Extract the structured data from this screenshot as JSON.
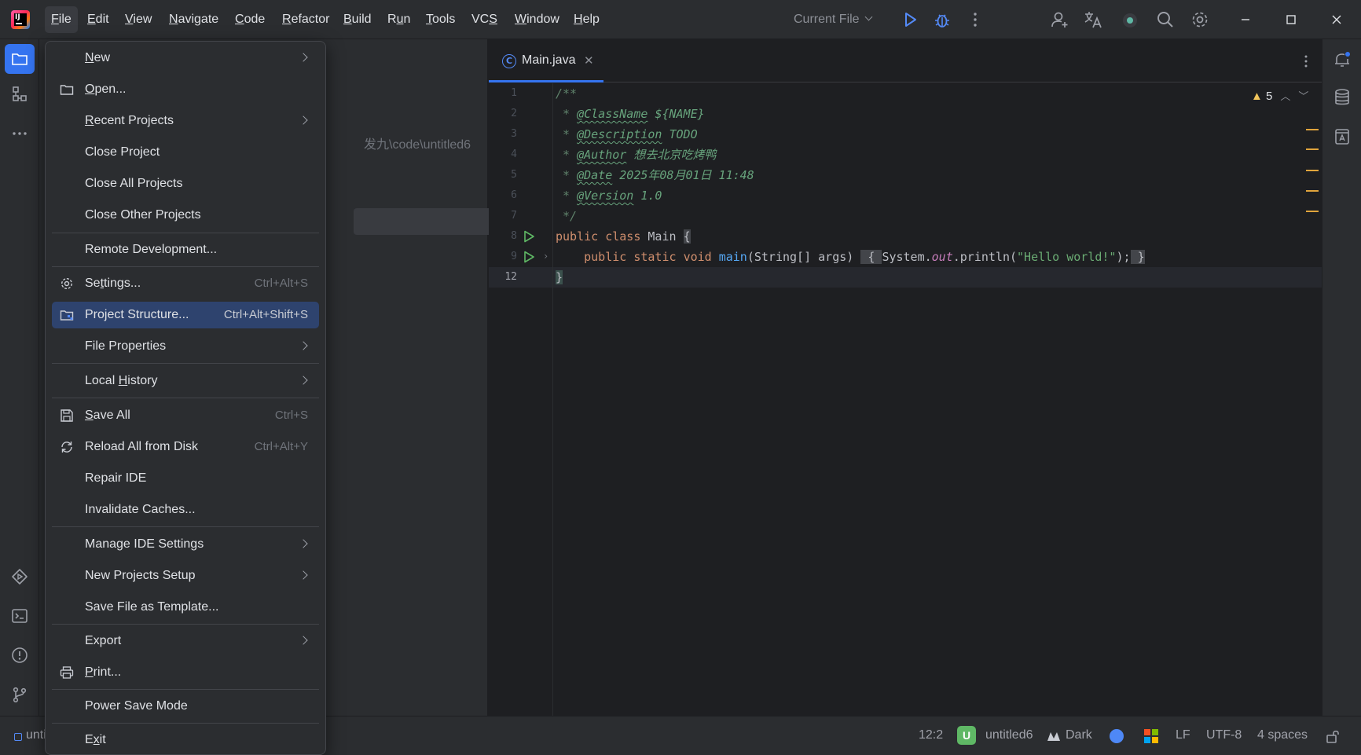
{
  "menubar": {
    "items": [
      {
        "label": "File",
        "mnemonic": "F"
      },
      {
        "label": "Edit",
        "mnemonic": "E"
      },
      {
        "label": "View",
        "mnemonic": "V"
      },
      {
        "label": "Navigate",
        "mnemonic": "N"
      },
      {
        "label": "Code",
        "mnemonic": "C"
      },
      {
        "label": "Refactor",
        "mnemonic": "R"
      },
      {
        "label": "Build",
        "mnemonic": "B"
      },
      {
        "label": "Run",
        "mnemonic": "u"
      },
      {
        "label": "Tools",
        "mnemonic": "T"
      },
      {
        "label": "VCS",
        "mnemonic": "S"
      },
      {
        "label": "Window",
        "mnemonic": "W"
      },
      {
        "label": "Help",
        "mnemonic": "H"
      }
    ],
    "active": "File"
  },
  "toolbar": {
    "run_config": "Current File",
    "icons": [
      "run-icon",
      "debug-icon",
      "more-vertical-icon",
      "add-user-icon",
      "translate-icon",
      "ai-assistant-icon",
      "search-icon",
      "settings-icon"
    ]
  },
  "window_controls": [
    "minimize-icon",
    "maximize-icon",
    "close-icon"
  ],
  "project_panel": {
    "path_fragment": "发九\\code\\untitled6"
  },
  "file_menu": {
    "items": [
      {
        "label": "New",
        "mnemonic": "N",
        "submenu": true
      },
      {
        "label": "Open...",
        "mnemonic": "O",
        "icon": "folder-icon"
      },
      {
        "label": "Recent Projects",
        "mnemonic": "R",
        "submenu": true
      },
      {
        "label": "Close Project"
      },
      {
        "label": "Close All Projects"
      },
      {
        "label": "Close Other Projects"
      },
      {
        "separator": true
      },
      {
        "label": "Remote Development..."
      },
      {
        "separator": true
      },
      {
        "label": "Settings...",
        "mnemonic": "t",
        "shortcut": "Ctrl+Alt+S",
        "icon": "gear-icon"
      },
      {
        "label": "Project Structure...",
        "shortcut": "Ctrl+Alt+Shift+S",
        "icon": "project-structure-icon",
        "selected": true
      },
      {
        "label": "File Properties",
        "submenu": true
      },
      {
        "separator": true
      },
      {
        "label": "Local History",
        "mnemonic": "H",
        "submenu": true
      },
      {
        "separator": true
      },
      {
        "label": "Save All",
        "mnemonic": "S",
        "shortcut": "Ctrl+S",
        "icon": "save-icon"
      },
      {
        "label": "Reload All from Disk",
        "shortcut": "Ctrl+Alt+Y",
        "icon": "reload-icon"
      },
      {
        "label": "Repair IDE"
      },
      {
        "label": "Invalidate Caches..."
      },
      {
        "separator": true
      },
      {
        "label": "Manage IDE Settings",
        "submenu": true
      },
      {
        "label": "New Projects Setup",
        "submenu": true
      },
      {
        "label": "Save File as Template..."
      },
      {
        "separator": true
      },
      {
        "label": "Export",
        "submenu": true
      },
      {
        "label": "Print...",
        "mnemonic": "P",
        "icon": "print-icon"
      },
      {
        "separator": true
      },
      {
        "label": "Power Save Mode"
      },
      {
        "separator": true
      },
      {
        "label": "Exit",
        "mnemonic": "x"
      }
    ]
  },
  "editor": {
    "tab": {
      "label": "Main.java",
      "icon": "java-class-icon"
    },
    "warnings": {
      "count": "5"
    },
    "line_numbers": [
      "1",
      "2",
      "3",
      "4",
      "5",
      "6",
      "7",
      "8",
      "9",
      "12"
    ],
    "current_line": "12",
    "doc": {
      "open": "/**",
      "class_tag": "@ClassName",
      "class_val": "${NAME}",
      "desc_tag": "@Description",
      "desc_val": "TODO",
      "author_tag": "@Author",
      "author_val": "想去北京吃烤鸭",
      "date_tag": "@Date",
      "date_val": "2025年08月01日 11:48",
      "version_tag": "@Version",
      "version_val": "1.0",
      "close": "*/"
    },
    "code": {
      "kw_public": "public",
      "kw_class": "class",
      "class_name": "Main",
      "kw_static": "static",
      "kw_void": "void",
      "method_name": "main",
      "params": "(String[] args)",
      "system": "System.",
      "out": "out",
      "println": ".println(",
      "string": "\"Hello world!\"",
      "stmt_end": ");",
      "open_brace": "{",
      "close_brace": "}"
    }
  },
  "statusbar": {
    "crumb": "unti",
    "caret_position": "12:2",
    "module_badge": "U",
    "module_name": "untitled6",
    "theme": "Dark",
    "line_separator": "LF",
    "encoding": "UTF-8",
    "indent": "4 spaces"
  },
  "colors": {
    "accent": "#3574f0",
    "menu_selection": "#2e436e",
    "warning": "#f2c55c",
    "background": "#1e1f22",
    "panel": "#2b2d30"
  }
}
